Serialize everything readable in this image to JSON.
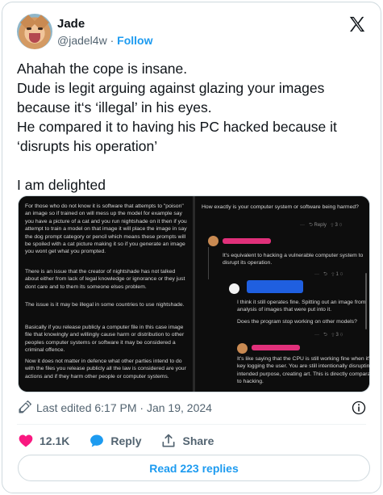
{
  "author": {
    "name": "Jade",
    "handle": "@jadel4w",
    "separator": "·",
    "follow_label": "Follow"
  },
  "tweet": {
    "text": "Ahahah the cope is insane.\nDude is legit arguing against glazing your images because it‘s ‘illegal’ in his eyes.\nHe compared it to having his PC hacked because it ‘disrupts his operation’\n\nI am delighted"
  },
  "screenshot": {
    "left_paragraphs": [
      "For those who do not know it is software that attempts to \"poison\" an image so if trained on will mess up the model for example say you have a picture of a cat and you run nightshade on it then if you attempt to train a model on that image it will place the image in say the dog prompt category or pencil which means these prompts will be spoiled with a cat picture making it so if you generate an image you wont get what you prompted.",
      "There is an issue that the creator of nightshade has not talked about either from lack of legal knowledge or ignorance or they just dont care and to them its someone elses problem.",
      "The issue is it may be illegal in some countries to use nightshade.",
      "Basically if you release publicly a computer file in this case image file that knowingly and willingly cause harm or distribution to other peoples computer systems or software it may be considered a criminal offence.",
      "Now it does not matter in defence what other parties intend to do with the files you release publicly all the law is considered are your actions and if they harm other people or computer systems."
    ],
    "right_top_text": "How exactly is your computer system or software being harmed?",
    "reply_label": "Reply",
    "vote_count_1": "3",
    "vote_count_2": "1",
    "vote_count_3": "3",
    "more_glyph": "···",
    "comment_1": "It's equivalent to hacking a vulnerable computer system to disrupt its operation.",
    "comment_2a": "I think it still operates fine. Spitting out an image from analysis of images that were put into it.",
    "comment_2b": "Does the program stop working on other models?",
    "comment_3": "It's like saying that the CPU is still working fine when it's key logging the user. You are still intentionally disrupting its intended purpose, creating art. This is directly comparable to hacking."
  },
  "footer": {
    "edited_text": "Last edited 6:17 PM · Jan 19, 2024",
    "likes": "12.1K",
    "reply_label": "Reply",
    "share_label": "Share",
    "read_replies_label": "Read 223 replies"
  },
  "colors": {
    "accent": "#1d9bf0",
    "like": "#f91880",
    "text_secondary": "#536471"
  },
  "icons": [
    "x-logo-icon",
    "pencil-icon",
    "info-icon",
    "heart-icon",
    "reply-bubble-icon",
    "share-icon"
  ]
}
